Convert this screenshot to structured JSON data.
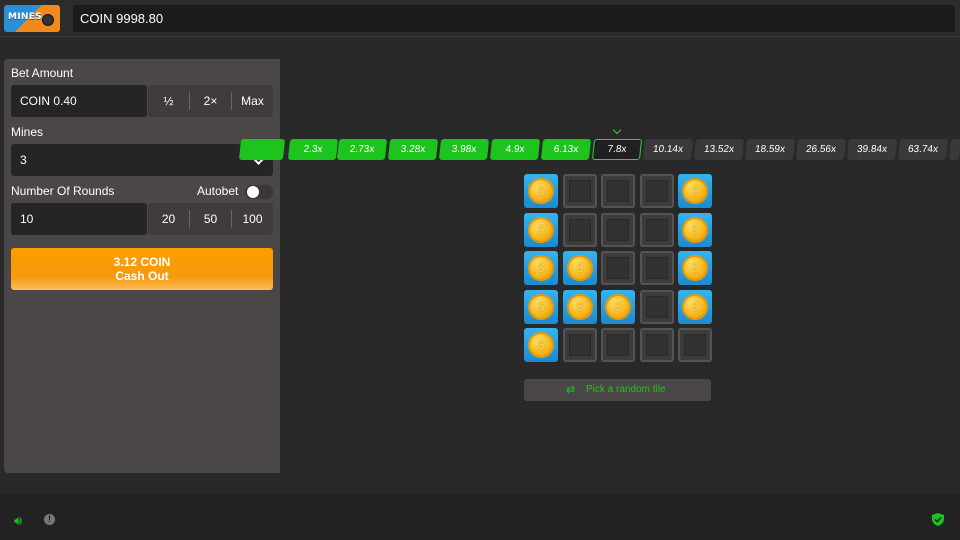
{
  "header": {
    "logo_text": "MINES",
    "balance": "COIN 9998.80"
  },
  "bet": {
    "label": "Bet Amount",
    "value": "COIN 0.40",
    "half": "½",
    "double": "2×",
    "max": "Max"
  },
  "mines": {
    "label": "Mines",
    "value": "3"
  },
  "rounds": {
    "label": "Number Of Rounds",
    "autobet_label": "Autobet",
    "autobet_on": false,
    "value": "10",
    "opt1": "20",
    "opt2": "50",
    "opt3": "100"
  },
  "cashout": {
    "amount": "3.12 COIN",
    "label": "Cash Out",
    "color": "#ff9d00"
  },
  "multipliers": [
    {
      "label": "",
      "state": "on"
    },
    {
      "label": "2.3x",
      "state": "on"
    },
    {
      "label": "2.73x",
      "state": "on"
    },
    {
      "label": "3.28x",
      "state": "on"
    },
    {
      "label": "3.98x",
      "state": "on"
    },
    {
      "label": "4.9x",
      "state": "on"
    },
    {
      "label": "6.13x",
      "state": "on"
    },
    {
      "label": "7.8x",
      "state": "cur"
    },
    {
      "label": "10.14x",
      "state": "off"
    },
    {
      "label": "13.52x",
      "state": "off"
    },
    {
      "label": "18.59x",
      "state": "off"
    },
    {
      "label": "26.56x",
      "state": "off"
    },
    {
      "label": "39.84x",
      "state": "off"
    },
    {
      "label": "63.74x",
      "state": "off"
    },
    {
      "label": "",
      "state": "off"
    }
  ],
  "grid": [
    [
      "coin",
      "closed",
      "closed",
      "closed",
      "coin"
    ],
    [
      "coin",
      "closed",
      "closed",
      "closed",
      "coin"
    ],
    [
      "coin",
      "coin",
      "closed",
      "closed",
      "coin"
    ],
    [
      "coin",
      "coin",
      "coin",
      "closed",
      "coin"
    ],
    [
      "coin",
      "closed",
      "closed",
      "closed",
      "closed"
    ]
  ],
  "coin_symbol": "$",
  "random_tile": {
    "label": "Pick a random tile",
    "icon": "shuffle-icon"
  },
  "footer": {
    "sound_icon": "speaker-icon",
    "info_icon": "info-icon",
    "fair_icon": "shield-check-icon"
  },
  "colors": {
    "accent": "#1ec41e",
    "tile_open": "#2aa3e6",
    "panel": "#4a4746"
  }
}
